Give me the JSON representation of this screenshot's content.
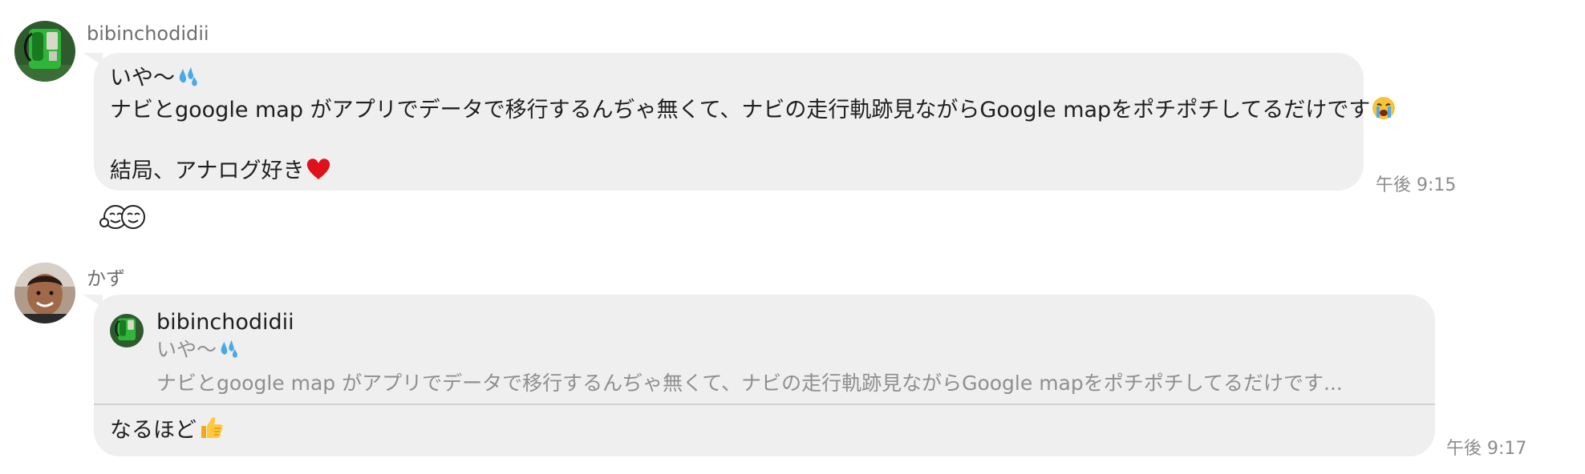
{
  "messages": [
    {
      "sender": "bibinchodidii",
      "lines": [
        "いや〜",
        "ナビとgoogle map がアプリでデータで移行するんぢゃ無くて、ナビの走行軌跡見ながらGoogle mapをポチポチしてるだけです",
        "",
        "結局、アナログ好き"
      ],
      "time": "午後 9:15",
      "reaction": "hugging-faces"
    },
    {
      "sender": "かず",
      "quote": {
        "name": "bibinchodidii",
        "line1": "いや〜",
        "line2": "ナビとgoogle map がアプリでデータで移行するんぢゃ無くて、ナビの走行軌跡見ながらGoogle mapをポチポチしてるだけです..."
      },
      "reply": "なるほど",
      "time": "午後 9:17"
    }
  ],
  "colors": {
    "bubble": "#efefef",
    "divider": "#d2d2d2",
    "time": "#8c8c8c",
    "sender": "#6f6f6f"
  }
}
